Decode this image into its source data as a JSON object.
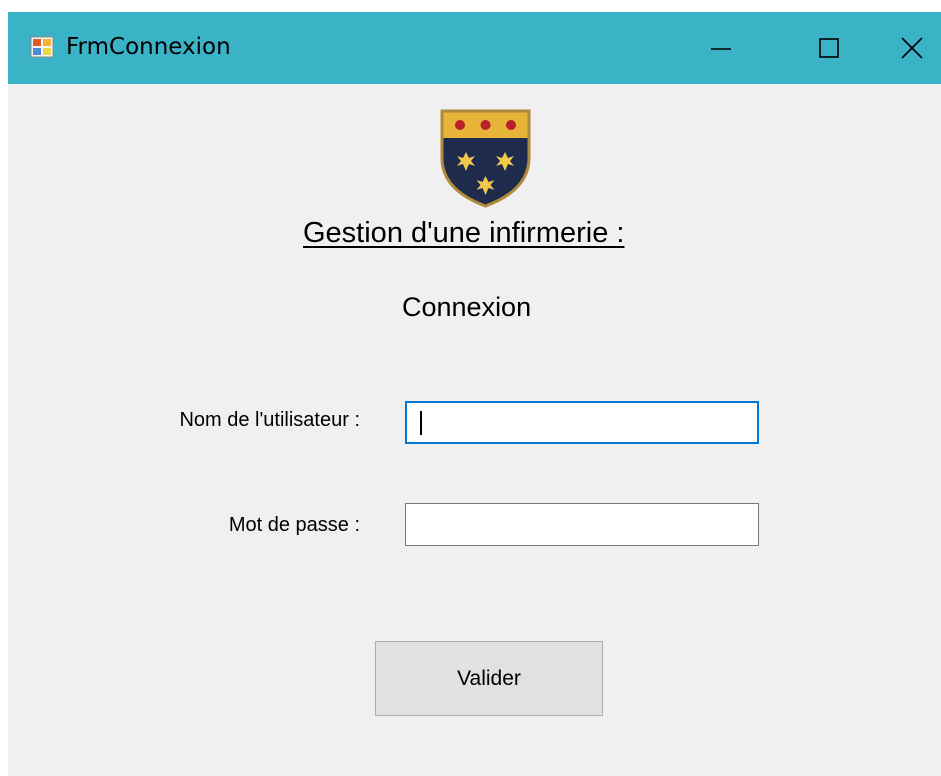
{
  "window": {
    "title": "FrmConnexion",
    "controls": {
      "minimize_icon": "minimize-icon",
      "maximize_icon": "maximize-icon",
      "close_icon": "close-icon"
    },
    "titlebar_color": "#3bb3c6"
  },
  "header": {
    "logo_icon": "coat-of-arms-icon",
    "title": "Gestion d'une infirmerie :",
    "subtitle": "Connexion"
  },
  "form": {
    "username_label": "Nom de l'utilisateur :",
    "username_value": "",
    "password_label": "Mot de passe :",
    "password_value": "",
    "submit_label": "Valider"
  },
  "colors": {
    "focus_border": "#0078d7",
    "background": "#f0f0f0",
    "button_face": "#e1e1e1"
  }
}
